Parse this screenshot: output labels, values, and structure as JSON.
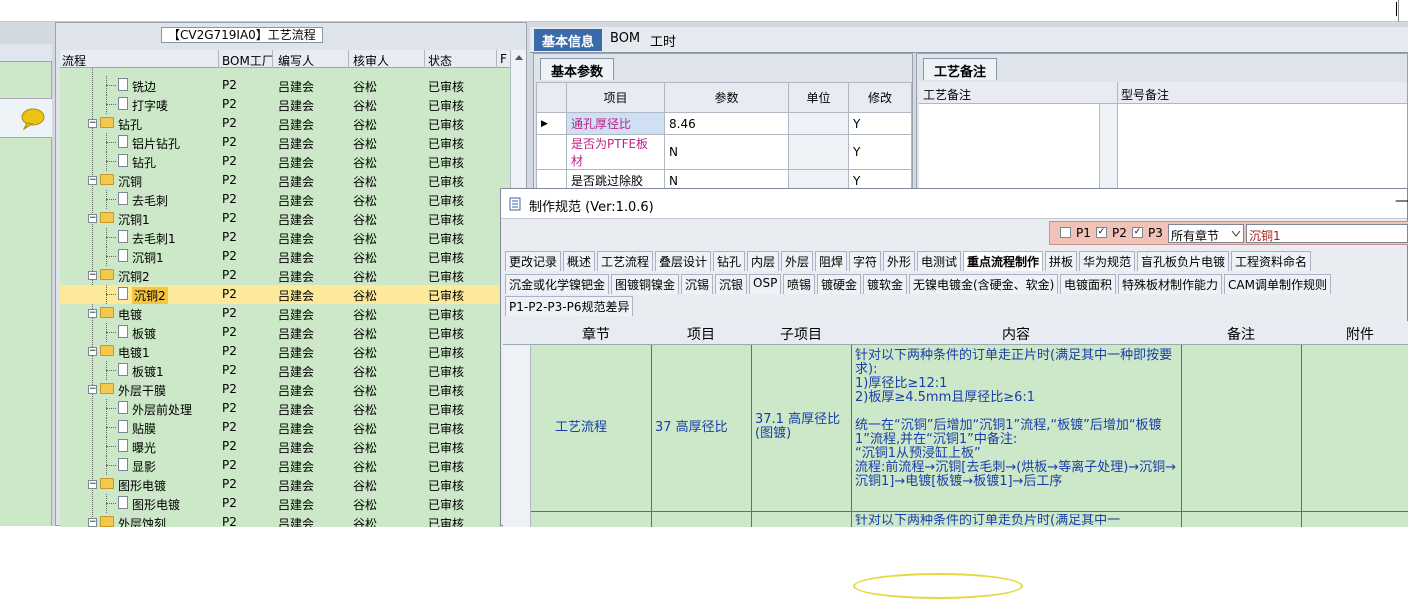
{
  "tree_panel": {
    "title": "【CV2G719IA0】工艺流程",
    "columns": [
      "流程",
      "BOM工厂",
      "编写人",
      "核审人",
      "状态",
      "F"
    ],
    "rows": [
      {
        "name": "铣边",
        "level": 2,
        "bom": "P2",
        "writer": "吕建会",
        "reviewer": "谷松",
        "status": "已审核"
      },
      {
        "name": "打字唛",
        "level": 2,
        "bom": "P2",
        "writer": "吕建会",
        "reviewer": "谷松",
        "status": "已审核"
      },
      {
        "name": "钻孔",
        "level": 1,
        "bom": "P2",
        "writer": "吕建会",
        "reviewer": "谷松",
        "status": "已审核"
      },
      {
        "name": "铝片钻孔",
        "level": 2,
        "bom": "P2",
        "writer": "吕建会",
        "reviewer": "谷松",
        "status": "已审核"
      },
      {
        "name": "钻孔",
        "level": 2,
        "bom": "P2",
        "writer": "吕建会",
        "reviewer": "谷松",
        "status": "已审核"
      },
      {
        "name": "沉铜",
        "level": 1,
        "bom": "P2",
        "writer": "吕建会",
        "reviewer": "谷松",
        "status": "已审核"
      },
      {
        "name": "去毛刺",
        "level": 2,
        "bom": "P2",
        "writer": "吕建会",
        "reviewer": "谷松",
        "status": "已审核"
      },
      {
        "name": "沉铜1",
        "level": 1,
        "bom": "P2",
        "writer": "吕建会",
        "reviewer": "谷松",
        "status": "已审核"
      },
      {
        "name": "去毛刺1",
        "level": 2,
        "bom": "P2",
        "writer": "吕建会",
        "reviewer": "谷松",
        "status": "已审核"
      },
      {
        "name": "沉铜1",
        "level": 2,
        "bom": "P2",
        "writer": "吕建会",
        "reviewer": "谷松",
        "status": "已审核"
      },
      {
        "name": "沉铜2",
        "level": 1,
        "bom": "P2",
        "writer": "吕建会",
        "reviewer": "谷松",
        "status": "已审核"
      },
      {
        "name": "沉铜2",
        "level": 2,
        "bom": "P2",
        "writer": "吕建会",
        "reviewer": "谷松",
        "status": "已审核",
        "selected": true
      },
      {
        "name": "电镀",
        "level": 1,
        "bom": "P2",
        "writer": "吕建会",
        "reviewer": "谷松",
        "status": "已审核"
      },
      {
        "name": "板镀",
        "level": 2,
        "bom": "P2",
        "writer": "吕建会",
        "reviewer": "谷松",
        "status": "已审核"
      },
      {
        "name": "电镀1",
        "level": 1,
        "bom": "P2",
        "writer": "吕建会",
        "reviewer": "谷松",
        "status": "已审核"
      },
      {
        "name": "板镀1",
        "level": 2,
        "bom": "P2",
        "writer": "吕建会",
        "reviewer": "谷松",
        "status": "已审核"
      },
      {
        "name": "外层干膜",
        "level": 1,
        "bom": "P2",
        "writer": "吕建会",
        "reviewer": "谷松",
        "status": "已审核"
      },
      {
        "name": "外层前处理",
        "level": 2,
        "bom": "P2",
        "writer": "吕建会",
        "reviewer": "谷松",
        "status": "已审核"
      },
      {
        "name": "贴膜",
        "level": 2,
        "bom": "P2",
        "writer": "吕建会",
        "reviewer": "谷松",
        "status": "已审核"
      },
      {
        "name": "曝光",
        "level": 2,
        "bom": "P2",
        "writer": "吕建会",
        "reviewer": "谷松",
        "status": "已审核"
      },
      {
        "name": "显影",
        "level": 2,
        "bom": "P2",
        "writer": "吕建会",
        "reviewer": "谷松",
        "status": "已审核"
      },
      {
        "name": "图形电镀",
        "level": 1,
        "bom": "P2",
        "writer": "吕建会",
        "reviewer": "谷松",
        "status": "已审核"
      },
      {
        "name": "图形电镀",
        "level": 2,
        "bom": "P2",
        "writer": "吕建会",
        "reviewer": "谷松",
        "status": "已审核"
      },
      {
        "name": "外层蚀刻",
        "level": 1,
        "bom": "P2",
        "writer": "吕建会",
        "reviewer": "谷松",
        "status": "已审核"
      }
    ]
  },
  "right_tabs": [
    "基本信息",
    "BOM",
    "工时"
  ],
  "basic_params": {
    "tab": "基本参数",
    "headers": [
      "项目",
      "参数",
      "单位",
      "修改"
    ],
    "rows": [
      {
        "item": "通孔厚径比",
        "value": "8.46",
        "unit": "",
        "edit": "Y"
      },
      {
        "item": "是否为PTFE板材",
        "value": "N",
        "unit": "",
        "edit": "Y"
      },
      {
        "item": "是否跳过除胶",
        "value": "N",
        "unit": "",
        "edit": "Y"
      }
    ]
  },
  "craft_remark": {
    "tab": "工艺备注",
    "headers": [
      "工艺备注",
      "型号备注"
    ]
  },
  "spec_window": {
    "title": "制作规范 (Ver:1.0.6)",
    "filter": {
      "p1": "P1",
      "p2": "P2",
      "p3": "P3",
      "chapter": "所有章节",
      "search": "沉铜1"
    },
    "tabs_row1": [
      "更改记录",
      "概述",
      "工艺流程",
      "叠层设计",
      "钻孔",
      "内层",
      "外层",
      "阻焊",
      "字符",
      "外形",
      "电测试",
      "重点流程制作",
      "拼板",
      "华为规范",
      "盲孔板负片电镀",
      "工程资料命名"
    ],
    "tabs_row2": [
      "沉金或化学镍钯金",
      "图镀铜镍金",
      "沉锡",
      "沉银",
      "OSP",
      "喷锡",
      "镀硬金",
      "镀软金",
      "无镍电镀金(含硬金、软金)",
      "电镀面积",
      "特殊板材制作能力",
      "CAM调单制作规则"
    ],
    "tabs_row3": [
      "P1-P2-P3-P6规范差异"
    ],
    "grid_headers": [
      "章节",
      "项目",
      "子项目",
      "内容",
      "备注",
      "附件"
    ],
    "row1": {
      "chapter": "工艺流程",
      "item": "37 高厚径比",
      "subitem": "37.1 高厚径比(图镀)",
      "content": [
        "针对以下两种条件的订单走正片时(满足其中一种即按要求):",
        "1)厚径比≥12:1",
        "2)板厚≥4.5mm且厚径比≥6:1",
        "",
        "统一在“沉铜”后增加“沉铜1”流程,“板镀”后增加“板镀1”流程,并在“沉铜1”中备注:",
        "“沉铜1从预浸缸上板”",
        "流程:前流程→沉铜[去毛刺→(烘板→等离子处理)→沉铜→沉铜1]→电镀[板镀→板镀1]→后工序"
      ]
    },
    "row2_content": "针对以下两种条件的订单走负片时(满足其中一"
  }
}
